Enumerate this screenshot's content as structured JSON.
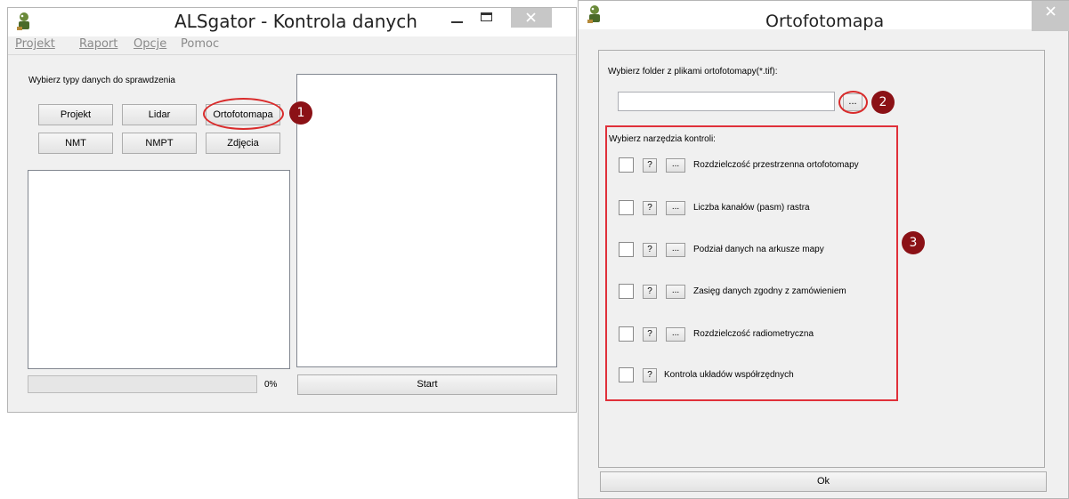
{
  "main_window": {
    "title": "ALSgator - Kontrola danych",
    "menu": [
      "Projekt",
      "Raport",
      "Opcje",
      "Pomoc"
    ],
    "section_label": "Wybierz typy danych do sprawdzenia",
    "buttons": [
      "Projekt",
      "Lidar",
      "Ortofotomapa",
      "NMT",
      "NMPT",
      "Zdjęcia"
    ],
    "progress_value": 0,
    "progress_text": "0%",
    "start_label": "Start"
  },
  "dialog": {
    "title": "Ortofotomapa",
    "folder_label": "Wybierz folder z plikami ortofotomapy(*.tif):",
    "folder_value": "",
    "browse_label": "...",
    "tools_label": "Wybierz narzędzia kontroli:",
    "tools": [
      {
        "help": "?",
        "more": "...",
        "label": "Rozdzielczość przestrzenna ortofotomapy"
      },
      {
        "help": "?",
        "more": "...",
        "label": "Liczba kanałów (pasm) rastra"
      },
      {
        "help": "?",
        "more": "...",
        "label": "Podział danych na arkusze mapy"
      },
      {
        "help": "?",
        "more": "...",
        "label": "Zasięg danych zgodny z zamówieniem"
      },
      {
        "help": "?",
        "more": "...",
        "label": "Rozdzielczość radiometryczna"
      },
      {
        "help": "?",
        "label": "Kontrola układów współrzędnych"
      }
    ],
    "ok_label": "Ok"
  },
  "callouts": [
    "1",
    "2",
    "3"
  ],
  "colors": {
    "callout_badge": "#8b1116",
    "callout_outline": "#d92b2b",
    "close_button": "#c7c7c7"
  }
}
